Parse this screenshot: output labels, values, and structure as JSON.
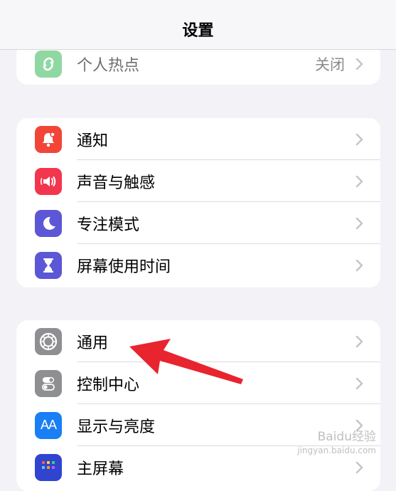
{
  "navbar": {
    "title": "设置"
  },
  "group1": {
    "items": [
      {
        "label": "个人热点",
        "value": "关闭",
        "icon": "hotspot-icon",
        "color": "#8fd8a2"
      }
    ]
  },
  "group2": {
    "items": [
      {
        "label": "通知",
        "icon": "bell-icon",
        "color": "#f24538"
      },
      {
        "label": "声音与触感",
        "icon": "speaker-icon",
        "color": "#f2364d"
      },
      {
        "label": "专注模式",
        "icon": "moon-icon",
        "color": "#5b57d6"
      },
      {
        "label": "屏幕使用时间",
        "icon": "hourglass-icon",
        "color": "#5b57d6"
      }
    ]
  },
  "group3": {
    "items": [
      {
        "label": "通用",
        "icon": "gear-icon",
        "color": "#8e8e93"
      },
      {
        "label": "控制中心",
        "icon": "toggles-icon",
        "color": "#8e8e93"
      },
      {
        "label": "显示与亮度",
        "icon": "text-size-icon",
        "icon_text": "AA",
        "color": "#1a7ef5"
      },
      {
        "label": "主屏幕",
        "icon": "home-screen-icon",
        "color": "#3044cf"
      }
    ]
  },
  "annotation": {
    "arrow_color": "#e8242f"
  },
  "watermark": {
    "line1": "Baidu经验",
    "line2": "jingyan.baidu.com"
  }
}
